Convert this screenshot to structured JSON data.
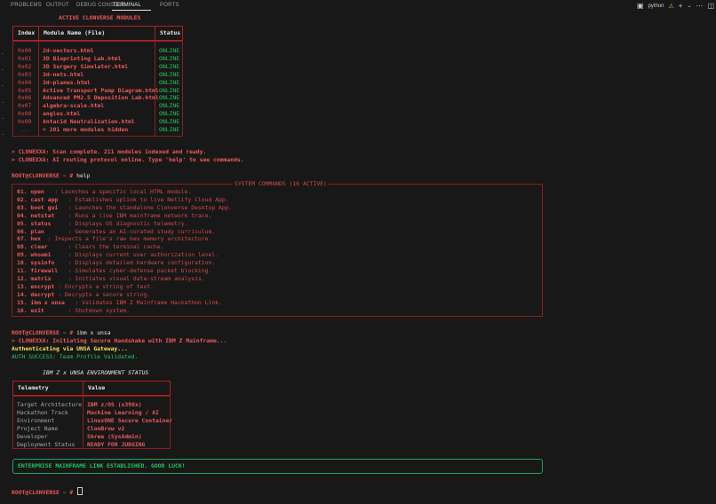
{
  "tabs": [
    {
      "label": "PROBLEMS"
    },
    {
      "label": "OUTPUT"
    },
    {
      "label": "DEBUG CONSOLE"
    },
    {
      "label": "TERMINAL"
    },
    {
      "label": "PORTS"
    }
  ],
  "terminal_kind": "python",
  "modules_title": "ACTIVE CLONVERSE MODULES",
  "modules_headers": {
    "index": "Index",
    "name": "Module Name (File)",
    "status": "Status"
  },
  "modules": [
    {
      "index": "0x00",
      "name": "2d-vectors.html",
      "status": "ONLINE"
    },
    {
      "index": "0x01",
      "name": "3D Bioprinting Lab.html",
      "status": "ONLINE"
    },
    {
      "index": "0x02",
      "name": "3D Surgery Simulator.html",
      "status": "ONLINE"
    },
    {
      "index": "0x03",
      "name": "3d-nets.html",
      "status": "ONLINE"
    },
    {
      "index": "0x04",
      "name": "3d-planes.html",
      "status": "ONLINE"
    },
    {
      "index": "0x05",
      "name": "Active Transport Pump Diagram.html",
      "status": "ONLINE"
    },
    {
      "index": "0x06",
      "name": "Advanced PM2.5 Deposition Lab.html",
      "status": "ONLINE"
    },
    {
      "index": "0x07",
      "name": "algebra-scale.html",
      "status": "ONLINE"
    },
    {
      "index": "0x08",
      "name": "angles.html",
      "status": "ONLINE"
    },
    {
      "index": "0x09",
      "name": "Antacid Neutralization.html",
      "status": "ONLINE"
    },
    {
      "index": "...",
      "name": "+ 201 more modules hidden",
      "status": "ONLINE"
    }
  ],
  "scan_lines": [
    "> CLONEXXA: Scan complete. 211 modules indexed and ready.",
    "> CLONEXXA: AI routing protocol online. Type 'help' to see commands."
  ],
  "prompt": "ROOT@CLONVERSE ~ #",
  "help_cmd": "help",
  "commands_title": "SYSTEM COMMANDS (16 ACTIVE)",
  "commands": [
    {
      "k": "01. open",
      "pad": "   ",
      "d": ": Launches a specific local HTML module."
    },
    {
      "k": "02. cast app",
      "pad": "   ",
      "d": ": Establishes uplink to live Netlify Cloud App."
    },
    {
      "k": "03. boot gui",
      "pad": "   ",
      "d": ": Launches the standalone Clonverse Desktop App."
    },
    {
      "k": "04. netstat",
      "pad": "    ",
      "d": ": Runs a live IBM mainframe network trace."
    },
    {
      "k": "05. status",
      "pad": "     ",
      "d": ": Displays OS diagnostic telemetry."
    },
    {
      "k": "06. plan",
      "pad": "       ",
      "d": ": Generates an AI-curated study curriculum."
    },
    {
      "k": "07. hex",
      "pad": "  ",
      "d": ": Inspects a file's raw hex memory architecture."
    },
    {
      "k": "08. clear",
      "pad": "      ",
      "d": ": Clears the terminal cache."
    },
    {
      "k": "09. whoami",
      "pad": "     ",
      "d": ": Displays current user authorization level."
    },
    {
      "k": "10. sysinfo",
      "pad": "    ",
      "d": ": Displays detailed hardware configuration."
    },
    {
      "k": "11. firewall",
      "pad": "   ",
      "d": ": Simulates cyber-defense packet blocking."
    },
    {
      "k": "12. matrix",
      "pad": "     ",
      "d": ": Initiates visual data-stream analysis."
    },
    {
      "k": "13. encrypt",
      "pad": " ",
      "d": ": Encrypts a string of text."
    },
    {
      "k": "14. decrypt",
      "pad": " ",
      "d": ": Decrypts a secure string."
    },
    {
      "k": "15. ibm x unsa",
      "pad": "   ",
      "d": ": Validates IBM Z Mainframe Hackathon Link."
    },
    {
      "k": "16. exit",
      "pad": "       ",
      "d": ": Shutdown system."
    }
  ],
  "ibm_cmd": "ibm x unsa",
  "handshake_line": "> CLONEXXA: Initiating Secure Handshake with IBM Z Mainframe...",
  "auth_line": "Authenticating via UNSA Gateway...",
  "auth_success": "AUTH SUCCESS: Team Profile Validated.",
  "env_title": "IBM Z x UNSA ENVIRONMENT STATUS",
  "env_headers": {
    "telemetry": "Telemetry",
    "value": "Value"
  },
  "env_rows": [
    {
      "t": "Target Architecture",
      "v": "IBM z/OS (s390x)"
    },
    {
      "t": "Hackathon Track",
      "v": "Machine Learning / AI"
    },
    {
      "t": "Environment",
      "v": "LinuxONE Secure Container"
    },
    {
      "t": "Project Name",
      "v": "ClonBrow v2"
    },
    {
      "t": "Developer",
      "v": "Shree (SysAdmin)"
    },
    {
      "t": "Deployment Status",
      "v": "READY FOR JUDGING"
    }
  ],
  "enterprise_banner": "ENTERPRISE MAINFRAME LINK ESTABLISHED. GOOD LUCK!"
}
